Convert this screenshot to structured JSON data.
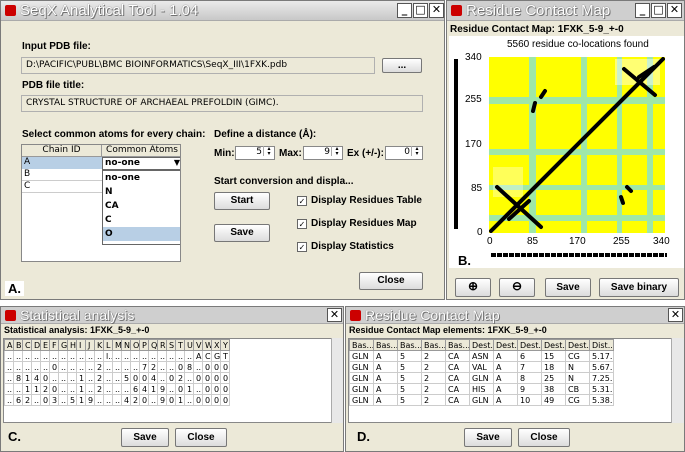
{
  "win_a": {
    "title": "SeqX Analytical Tool - 1.04",
    "input_label": "Input PDB file:",
    "input_path": "D:\\PACIFIC\\PUBL\\BMC BIOINFORMATICS\\SeqX_III\\1FXK.pdb",
    "browse_label": "...",
    "title_label": "PDB file title:",
    "title_value": "CRYSTAL STRUCTURE OF ARCHAEAL PREFOLDIN (GIMC).",
    "atoms_label": "Select common atoms for every chain:",
    "col_chain": "Chain ID",
    "col_atoms": "Common Atoms",
    "chains": [
      "A",
      "B",
      "C"
    ],
    "selected_atom": "no-one",
    "atom_options": [
      "no-one",
      "N",
      "CA",
      "C",
      "O"
    ],
    "distance_label": "Define a distance (Å):",
    "min_label": "Min:",
    "min_value": "5",
    "max_label": "Max:",
    "max_value": "9",
    "ex_label": "Ex (+/-):",
    "ex_value": "0",
    "start_label": "Start conversion and displa...",
    "start_btn": "Start",
    "save_btn": "Save",
    "opt_table": "Display Residues Table",
    "opt_map": "Display Residues Map",
    "opt_stats": "Display Statistics",
    "close_btn": "Close",
    "corner": "A."
  },
  "win_b": {
    "title": "Residue Contact Map",
    "subtitle": "Residue Contact Map: 1FXK_5-9_+-0",
    "found": "5560 residue co-locations found",
    "yticks": [
      "340",
      "255",
      "170",
      "85",
      "0"
    ],
    "xticks": [
      "0",
      "85",
      "170",
      "255",
      "340"
    ],
    "save_btn": "Save",
    "save_binary_btn": "Save binary",
    "corner": "B.",
    "colors": {
      "bg": "#ffff00",
      "stripe": "#7fdfe0",
      "dark": "#000000"
    }
  },
  "win_c": {
    "title": "Statistical analysis",
    "subtitle": "Statistical analysis: 1FXK_5-9_+-0",
    "columns": [
      "A",
      "B",
      "C",
      "D",
      "E",
      "F",
      "G",
      "H",
      "I",
      "J",
      "K",
      "L",
      "M",
      "N",
      "O",
      "P",
      "Q",
      "R",
      "S",
      "T",
      "U",
      "V",
      "W",
      "X",
      "Y"
    ],
    "rows": [
      [
        "...",
        "...",
        "...",
        "...",
        "...",
        "...",
        "...",
        "...",
        "...",
        "...",
        "...",
        "l...",
        "...",
        "...",
        "...",
        "...",
        "...",
        "...",
        "...",
        "...",
        "...",
        "A",
        "C",
        "G",
        "T"
      ],
      [
        "...",
        "...",
        "...",
        "...",
        "...",
        "0",
        "...",
        "...",
        "...",
        "...",
        "2",
        "...",
        "...",
        "...",
        "...",
        "7",
        "2",
        "...",
        "...",
        "0",
        "8",
        "...",
        "0",
        "0",
        "0"
      ],
      [
        "...",
        "8",
        "1",
        "4",
        "0",
        "...",
        "...",
        "...",
        "1",
        "...",
        "2",
        "...",
        "...",
        "5",
        "0",
        "0",
        "4",
        "...",
        "0",
        "2",
        "...",
        "0",
        "0",
        "0",
        "0"
      ],
      [
        "...",
        "...",
        "1",
        "1",
        "2",
        "0",
        "...",
        "...",
        "1",
        "...",
        "2",
        "...",
        "...",
        "...",
        "6",
        "4",
        "1",
        "9",
        "...",
        "0",
        "1",
        "...",
        "0",
        "0",
        "0"
      ],
      [
        "...",
        "6",
        "2",
        "...",
        "0",
        "3",
        "...",
        "5",
        "1",
        "9",
        "...",
        "...",
        "...",
        "4",
        "2",
        "0",
        "...",
        "9",
        "0",
        "1",
        "...",
        "0",
        "0",
        "0",
        "0"
      ]
    ],
    "save_btn": "Save",
    "close_btn": "Close",
    "corner": "C."
  },
  "win_d": {
    "title": "Residue Contact Map",
    "subtitle": "Residue Contact Map elements: 1FXK_5-9_+-0",
    "columns": [
      "Bas...",
      "Bas...",
      "Bas...",
      "Bas...",
      "Bas...",
      "Dest...",
      "Dest...",
      "Dest...",
      "Dest...",
      "Dest...",
      "Dist..."
    ],
    "rows": [
      [
        "GLN",
        "A",
        "5",
        "2",
        "CA",
        "ASN",
        "A",
        "6",
        "15",
        "CG",
        "5.17..."
      ],
      [
        "GLN",
        "A",
        "5",
        "2",
        "CA",
        "VAL",
        "A",
        "7",
        "18",
        "N",
        "5.67..."
      ],
      [
        "GLN",
        "A",
        "5",
        "2",
        "CA",
        "GLN",
        "A",
        "8",
        "25",
        "N",
        "7.25..."
      ],
      [
        "GLN",
        "A",
        "5",
        "2",
        "CA",
        "HIS",
        "A",
        "9",
        "38",
        "CB",
        "5.31..."
      ],
      [
        "GLN",
        "A",
        "5",
        "2",
        "CA",
        "GLN",
        "A",
        "10",
        "49",
        "CG",
        "5.38..."
      ]
    ],
    "save_btn": "Save",
    "close_btn": "Close",
    "corner": "D."
  }
}
